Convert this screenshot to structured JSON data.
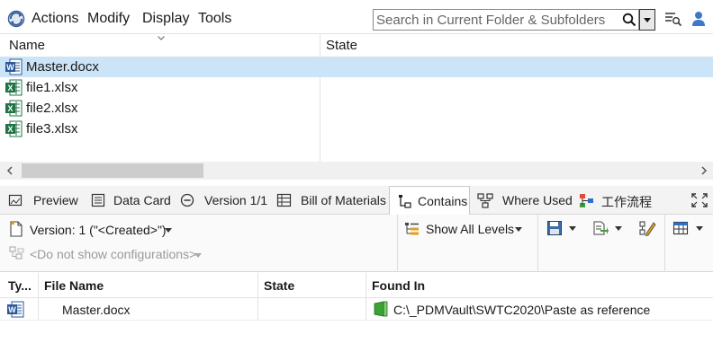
{
  "menu": {
    "actions": "Actions",
    "modify": "Modify",
    "display": "Display",
    "tools": "Tools"
  },
  "search": {
    "placeholder": "Search in Current Folder & Subfolders"
  },
  "file_list": {
    "columns": [
      "Name",
      "State"
    ],
    "rows": [
      {
        "name": "Master.docx",
        "type": "word",
        "state": ""
      },
      {
        "name": "file1.xlsx",
        "type": "excel",
        "state": ""
      },
      {
        "name": "file2.xlsx",
        "type": "excel",
        "state": ""
      },
      {
        "name": "file3.xlsx",
        "type": "excel",
        "state": ""
      }
    ]
  },
  "tabs": [
    {
      "label": "Preview",
      "icon": "preview-icon"
    },
    {
      "label": "Data Card",
      "icon": "data-card-icon"
    },
    {
      "label": "Version 1/1",
      "icon": "version-icon"
    },
    {
      "label": "Bill of Materials",
      "icon": "bom-icon"
    },
    {
      "label": "Contains",
      "icon": "contains-icon"
    },
    {
      "label": "Where Used",
      "icon": "where-used-icon"
    },
    {
      "label": "工作流程",
      "icon": "workflow-icon"
    }
  ],
  "toolbar": {
    "version": "Version: 1 (\"<Created>\")",
    "config": "<Do not show configurations>",
    "levels": "Show All Levels"
  },
  "contains_table": {
    "columns": [
      "Ty...",
      "File Name",
      "State",
      "Found In"
    ],
    "rows": [
      {
        "type": "word",
        "file_name": "Master.docx",
        "state": "",
        "found_in": "C:\\_PDMVault\\SWTC2020\\Paste as reference"
      }
    ]
  },
  "colors": {
    "selection": "#cce4f7",
    "word_blue": "#2b579a",
    "excel_green": "#217346",
    "folder_green": "#3aa335"
  }
}
